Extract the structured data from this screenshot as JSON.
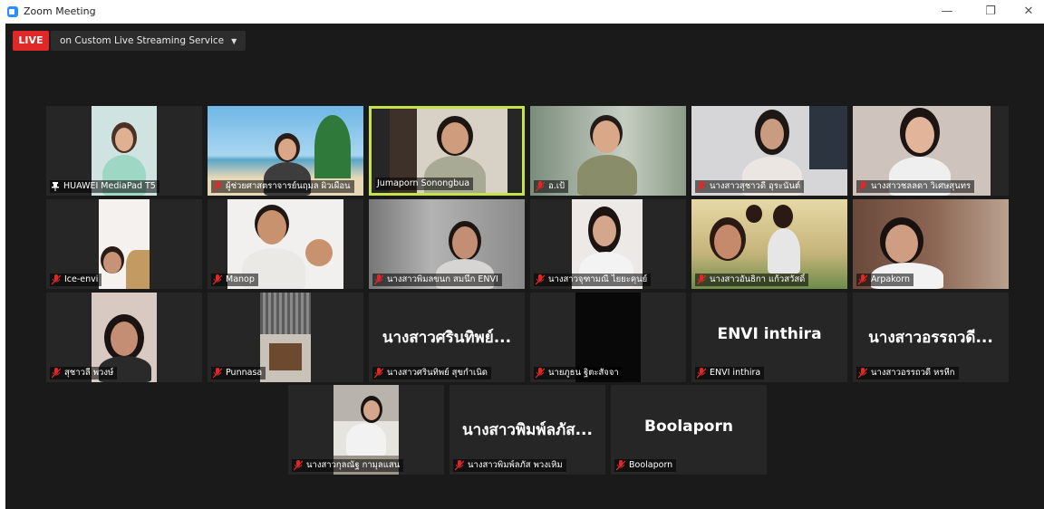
{
  "window": {
    "title": "Zoom Meeting",
    "minimize": "—",
    "maximize": "❐",
    "close": "✕"
  },
  "live": {
    "badge": "LIVE",
    "service": "on Custom Live Streaming Service"
  },
  "participants": [
    {
      "name": "HUAWEI MediaPad T5",
      "pinned": true,
      "muted": false
    },
    {
      "name": "ผู้ช่วยศาสตราจารย์นฤมล ผิวเผือน",
      "muted": true
    },
    {
      "name": "Jumaporn Sonongbua",
      "muted": false,
      "speaking": true
    },
    {
      "name": "อ.เป้",
      "muted": true
    },
    {
      "name": "นางสาวสุชาวดี อุระนันต์",
      "muted": true
    },
    {
      "name": "นางสาวชลลดา วิเศษสุนทร",
      "muted": true
    },
    {
      "name": "Ice-envi",
      "muted": true
    },
    {
      "name": "Manop",
      "muted": true
    },
    {
      "name": "นางสาวพิมลขนก สมนึก ENVI",
      "muted": true
    },
    {
      "name": "นางสาวจุฑามณี ไยยะคุนย์",
      "muted": true
    },
    {
      "name": "นางสาวอันธิกา แก้วสวัสดิ์",
      "muted": true
    },
    {
      "name": "Arpakorn",
      "muted": true
    },
    {
      "name": "สุชาวลี พวงษ์",
      "muted": true
    },
    {
      "name": "Punnasa",
      "muted": true
    },
    {
      "name": "นางสาวศรินทิพย์ สุขกำเนิด",
      "display": "นางสาวศรินทิพย์...",
      "muted": true
    },
    {
      "name": "นายภูธน ฐิตะสัจจา",
      "muted": true
    },
    {
      "name": "ENVI inthira",
      "display": "ENVI inthira",
      "muted": true
    },
    {
      "name": "นางสาวอรรถวดี หรหีก",
      "display": "นางสาวอรรถวดี...",
      "muted": true
    },
    {
      "name": "นางสาวกุลณัฐ กามุลแสน",
      "muted": true
    },
    {
      "name": "นางสาวพิมพ์ลภัส พวงเหิม",
      "display": "นางสาวพิมพ์ลภัส...",
      "muted": true
    },
    {
      "name": "Boolaporn",
      "display": "Boolaporn",
      "muted": true
    }
  ],
  "colors": {
    "live": "#e02828",
    "active_speaker": "#c7e24a",
    "muted_mic": "#e02828",
    "background": "#1a1a1a",
    "tile": "#262626"
  }
}
